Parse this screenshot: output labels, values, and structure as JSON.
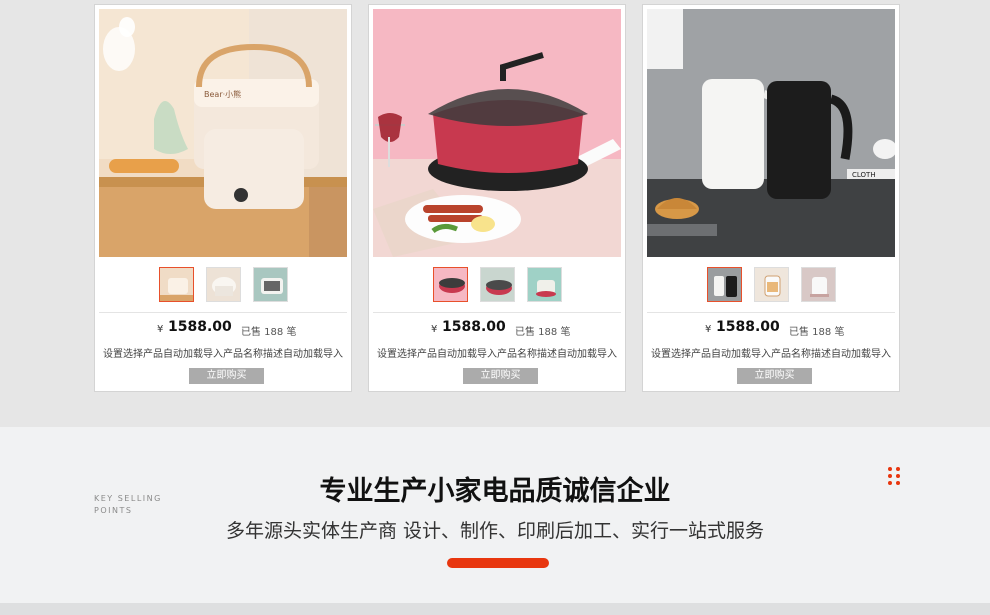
{
  "products": [
    {
      "image_icon": "folding-washer-photo",
      "thumb_icons": [
        "washer-thumb-1",
        "rice-cooker-thumb",
        "sandwich-maker-thumb"
      ],
      "currency": "¥",
      "price": "1588.00",
      "sold": "已售 188 笔",
      "description": "设置选择产品自动加载导入产品名称描述自动加载导入",
      "buy_label": "立即购买"
    },
    {
      "image_icon": "electric-hot-pot-photo",
      "thumb_icons": [
        "hot-pot-thumb-1",
        "hot-pot-thumb-2",
        "hot-pot-thumb-3"
      ],
      "currency": "¥",
      "price": "1588.00",
      "sold": "已售 188 笔",
      "description": "设置选择产品自动加载导入产品名称描述自动加载导入",
      "buy_label": "立即购买"
    },
    {
      "image_icon": "electric-kettle-photo",
      "thumb_icons": [
        "kettle-thumb-1",
        "kettle-thumb-2",
        "kettle-thumb-3"
      ],
      "currency": "¥",
      "price": "1588.00",
      "sold": "已售 188 笔",
      "description": "设置选择产品自动加载导入产品名称描述自动加载导入",
      "buy_label": "立即购买"
    }
  ],
  "banner": {
    "tag_line1": "KEY SELLING",
    "tag_line2": "POINTS",
    "headline": "专业生产小家电品质诚信企业",
    "subline": "多年源头实体生产商 设计、制作、印刷后加工、实行一站式服务",
    "accent_color": "#e8360e"
  }
}
